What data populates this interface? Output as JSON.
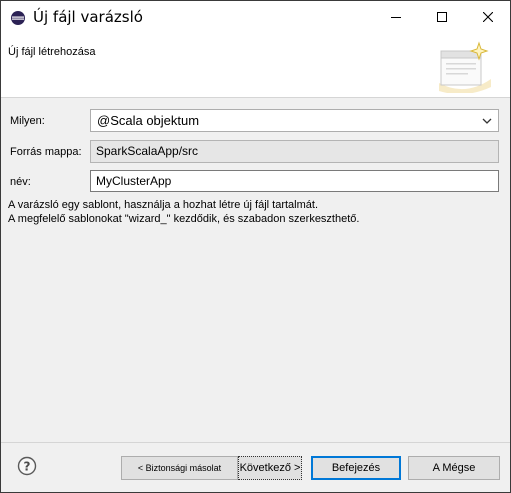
{
  "window": {
    "title": "Új fájl varázsló"
  },
  "banner": {
    "title": "Új fájl létrehozása"
  },
  "form": {
    "type_label": "Milyen:",
    "type_value": "@Scala objektum",
    "folder_label": "Forrás mappa:",
    "folder_value": "SparkScalaApp/src",
    "name_label": "név:",
    "name_value": "MyClusterApp"
  },
  "description": {
    "line1": "A varázsló egy sablont, használja a hozhat létre új fájl tartalmát.",
    "line2": "A megfelelő sablonokat \"wizard_\" kezdődik, és szabadon szerkeszthető."
  },
  "buttons": {
    "back": "< Biztonsági másolat",
    "next": "Következő >",
    "finish": "Befejezés",
    "cancel": "A Mégse"
  },
  "colors": {
    "accent": "#0078d7",
    "background": "#f0f0f0"
  }
}
